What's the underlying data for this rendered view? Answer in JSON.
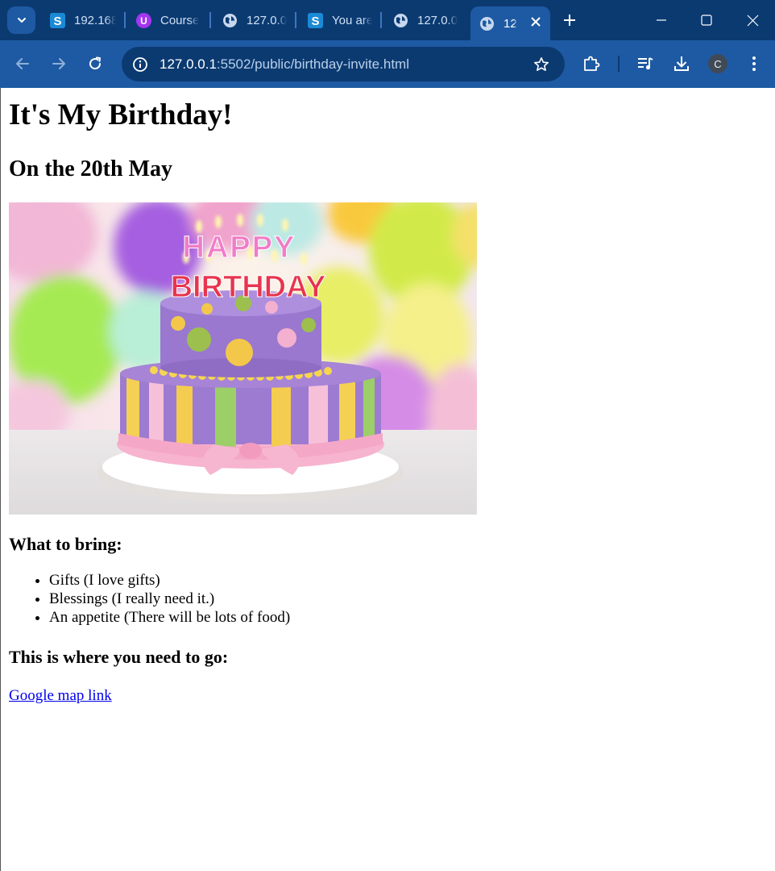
{
  "browser": {
    "tabs": [
      {
        "title": "192.168",
        "favicon": "s-app-icon"
      },
      {
        "title": "Course",
        "favicon": "u-app-icon"
      },
      {
        "title": "127.0.0",
        "favicon": "globe-icon"
      },
      {
        "title": "You are",
        "favicon": "s-app-icon"
      },
      {
        "title": "127.0.0",
        "favicon": "globe-icon"
      },
      {
        "title": "12",
        "favicon": "globe-icon",
        "active": true
      }
    ],
    "address": {
      "host": "127.0.0.1",
      "rest": ":5502/public/birthday-invite.html"
    },
    "profile_initial": "C",
    "colors": {
      "tabstrip": "#0b3a71",
      "toolbar": "#1e5aa3"
    }
  },
  "page": {
    "title": "It's My Birthday!",
    "date": "On the 20th May",
    "image": {
      "candle_letters_top": "HAPPY",
      "candle_letters_bottom": "BIRTHDAY"
    },
    "bring_heading": "What to bring:",
    "bring_items": [
      "Gifts (I love gifts)",
      "Blessings (I really need it.)",
      "An appetite (There will be lots of food)"
    ],
    "location_heading": "This is where you need to go:",
    "map_link": "Google map link"
  }
}
